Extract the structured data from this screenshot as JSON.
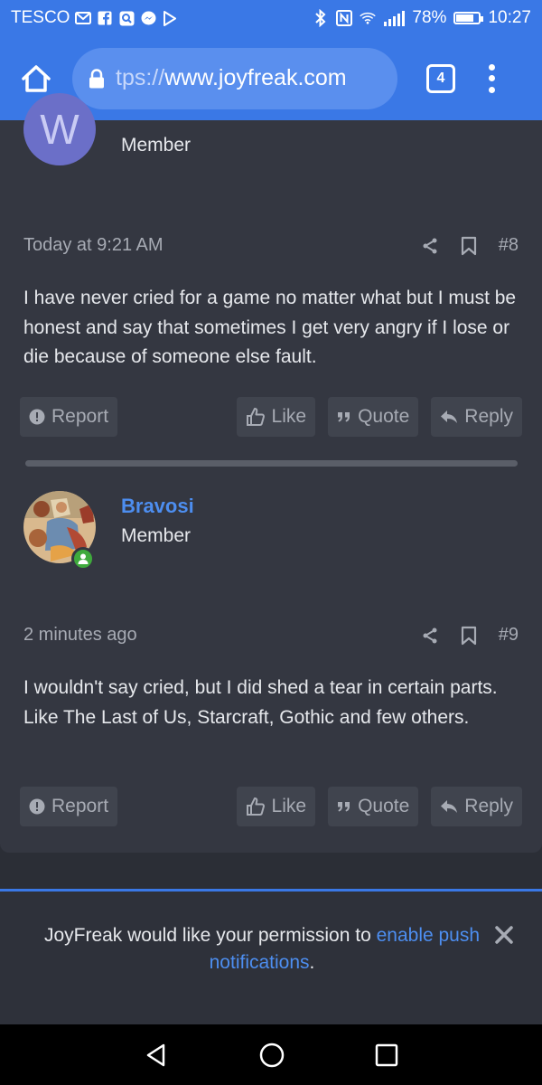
{
  "status_bar": {
    "carrier": "TESCO",
    "battery": "78%",
    "battery_level": 0.78,
    "time": "10:27"
  },
  "browser": {
    "url_prefix": "tps://",
    "url_main": "www.joyfreak.com",
    "tab_count": "4"
  },
  "posts": [
    {
      "role": "Member",
      "avatar_letter": "W",
      "timestamp": "Today at 9:21 AM",
      "number": "#8",
      "body": "I have never cried for a game no matter what but I must be honest and say that sometimes I get very angry if I lose or die because of someone else fault."
    },
    {
      "username": "Bravosi",
      "role": "Member",
      "timestamp": "2 minutes ago",
      "number": "#9",
      "body": "I wouldn't say cried, but I did shed a tear in certain parts. Like The Last of Us, Starcraft, Gothic and few others."
    }
  ],
  "post_actions": {
    "report": "Report",
    "like": "Like",
    "quote": "Quote",
    "reply": "Reply"
  },
  "push_notice": {
    "text_before": "JoyFreak would like your permission to ",
    "link": "enable push notifications",
    "text_after": "."
  },
  "colors": {
    "accent": "#3a78e6",
    "link": "#4d8ef0",
    "background": "#2b2e36",
    "card": "#343741"
  }
}
